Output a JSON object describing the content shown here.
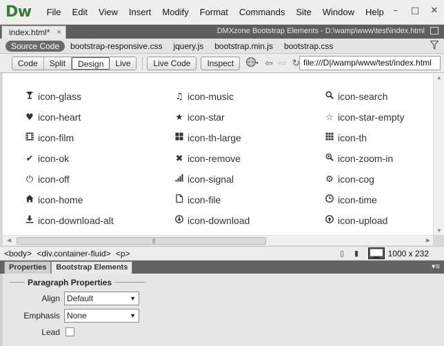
{
  "app": {
    "logo": "Dw"
  },
  "menu": [
    "File",
    "Edit",
    "View",
    "Insert",
    "Modify",
    "Format",
    "Commands",
    "Site",
    "Window",
    "Help"
  ],
  "document": {
    "tab_label": "index.html*",
    "close_glyph": "×",
    "path": "DMXzone Bootstrap Elements - D:\\wamp\\www\\test\\index.html"
  },
  "related_files": [
    "Source Code",
    "bootstrap-responsive.css",
    "jquery.js",
    "bootstrap.min.js",
    "bootstrap.css"
  ],
  "toolbar": {
    "views": [
      "Code",
      "Split",
      "Design",
      "Live"
    ],
    "active_view": "Design",
    "live_code": "Live Code",
    "inspect": "Inspect",
    "url": "file:///D|/wamp/www/test/index.html"
  },
  "icons": [
    [
      {
        "icon": "glass-icon",
        "label": "icon-glass"
      },
      {
        "icon": "music-icon",
        "label": "icon-music"
      },
      {
        "icon": "search-icon",
        "label": "icon-search"
      }
    ],
    [
      {
        "icon": "heart-icon",
        "label": "icon-heart"
      },
      {
        "icon": "star-icon",
        "label": "icon-star"
      },
      {
        "icon": "star-empty-icon",
        "label": "icon-star-empty"
      }
    ],
    [
      {
        "icon": "film-icon",
        "label": "icon-film"
      },
      {
        "icon": "th-large-icon",
        "label": "icon-th-large"
      },
      {
        "icon": "th-icon",
        "label": "icon-th"
      }
    ],
    [
      {
        "icon": "ok-icon",
        "label": "icon-ok"
      },
      {
        "icon": "remove-icon",
        "label": "icon-remove"
      },
      {
        "icon": "zoom-in-icon",
        "label": "icon-zoom-in"
      }
    ],
    [
      {
        "icon": "off-icon",
        "label": "icon-off"
      },
      {
        "icon": "signal-icon",
        "label": "icon-signal"
      },
      {
        "icon": "cog-icon",
        "label": "icon-cog"
      }
    ],
    [
      {
        "icon": "home-icon",
        "label": "icon-home"
      },
      {
        "icon": "file-icon",
        "label": "icon-file"
      },
      {
        "icon": "time-icon",
        "label": "icon-time"
      }
    ],
    [
      {
        "icon": "download-alt-icon",
        "label": "icon-download-alt"
      },
      {
        "icon": "download-icon",
        "label": "icon-download"
      },
      {
        "icon": "upload-icon",
        "label": "icon-upload"
      }
    ]
  ],
  "status": {
    "tags": [
      "<body>",
      "<div.container-fluid>",
      "<p>"
    ],
    "window_size": "1000 x 232"
  },
  "properties": {
    "tabs": [
      "Properties",
      "Bootstrap Elements"
    ],
    "active_tab": "Bootstrap Elements",
    "section_title": "Paragraph Properties",
    "align_label": "Align",
    "align_value": "Default",
    "emphasis_label": "Emphasis",
    "emphasis_value": "None",
    "lead_label": "Lead"
  }
}
